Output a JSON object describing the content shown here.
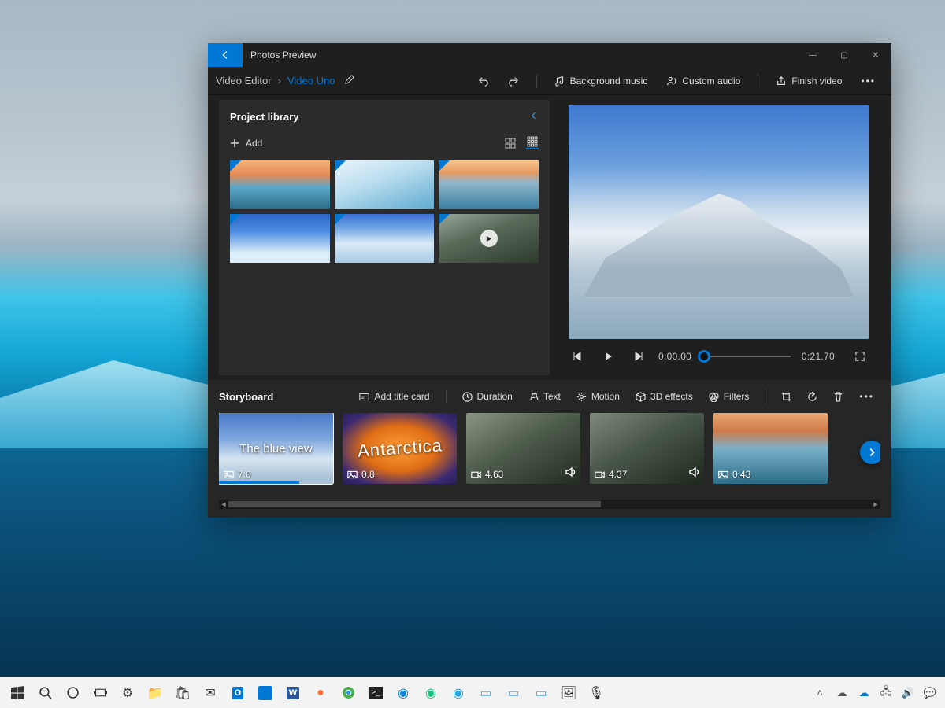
{
  "colors": {
    "accent": "#0078d4"
  },
  "titlebar": {
    "app_name": "Photos Preview"
  },
  "breadcrumb": {
    "root": "Video Editor",
    "leaf": "Video Uno"
  },
  "commands": {
    "undo": "Undo",
    "redo": "Redo",
    "background_music": "Background music",
    "custom_audio": "Custom audio",
    "finish_video": "Finish video",
    "more": "More"
  },
  "library": {
    "title": "Project library",
    "add_label": "Add",
    "views": {
      "large": "Large thumbnails",
      "small": "Small thumbnails"
    },
    "items": [
      {
        "kind": "photo"
      },
      {
        "kind": "photo"
      },
      {
        "kind": "photo"
      },
      {
        "kind": "photo"
      },
      {
        "kind": "photo"
      },
      {
        "kind": "video"
      }
    ]
  },
  "player": {
    "prev_frame": "Previous frame",
    "play": "Play",
    "next_frame": "Next frame",
    "current_time": "0:00.00",
    "total_time": "0:21.70",
    "fullscreen": "Full screen"
  },
  "storyboard": {
    "title": "Storyboard",
    "toolbar": {
      "add_title_card": "Add title card",
      "duration": "Duration",
      "text": "Text",
      "motion": "Motion",
      "effects_3d": "3D effects",
      "filters": "Filters",
      "crop": "Resize",
      "rotate": "Rotate",
      "delete": "Delete",
      "more": "More"
    },
    "clips": [
      {
        "type": "title",
        "caption": "The blue view",
        "duration": "7.0",
        "icon": "image",
        "selected": true,
        "progress": 70
      },
      {
        "type": "title",
        "caption": "Antarctica",
        "duration": "0.8",
        "icon": "image"
      },
      {
        "type": "video",
        "duration": "4.63",
        "icon": "video",
        "audio": true
      },
      {
        "type": "video",
        "duration": "4.37",
        "icon": "video",
        "audio": true
      },
      {
        "type": "image",
        "duration": "0.43",
        "icon": "image"
      }
    ]
  },
  "taskbar": {
    "apps": [
      "start",
      "search",
      "cortana",
      "task-view",
      "settings",
      "explorer",
      "store",
      "mail",
      "outlook",
      "photos",
      "word",
      "firefox",
      "chrome",
      "terminal",
      "edge",
      "edge-dev",
      "edge-beta",
      "notes",
      "remote",
      "pictures",
      "camera",
      "mic"
    ],
    "tray": [
      "chevron-up",
      "cloud",
      "onedrive",
      "network",
      "volume",
      "notifications"
    ]
  }
}
